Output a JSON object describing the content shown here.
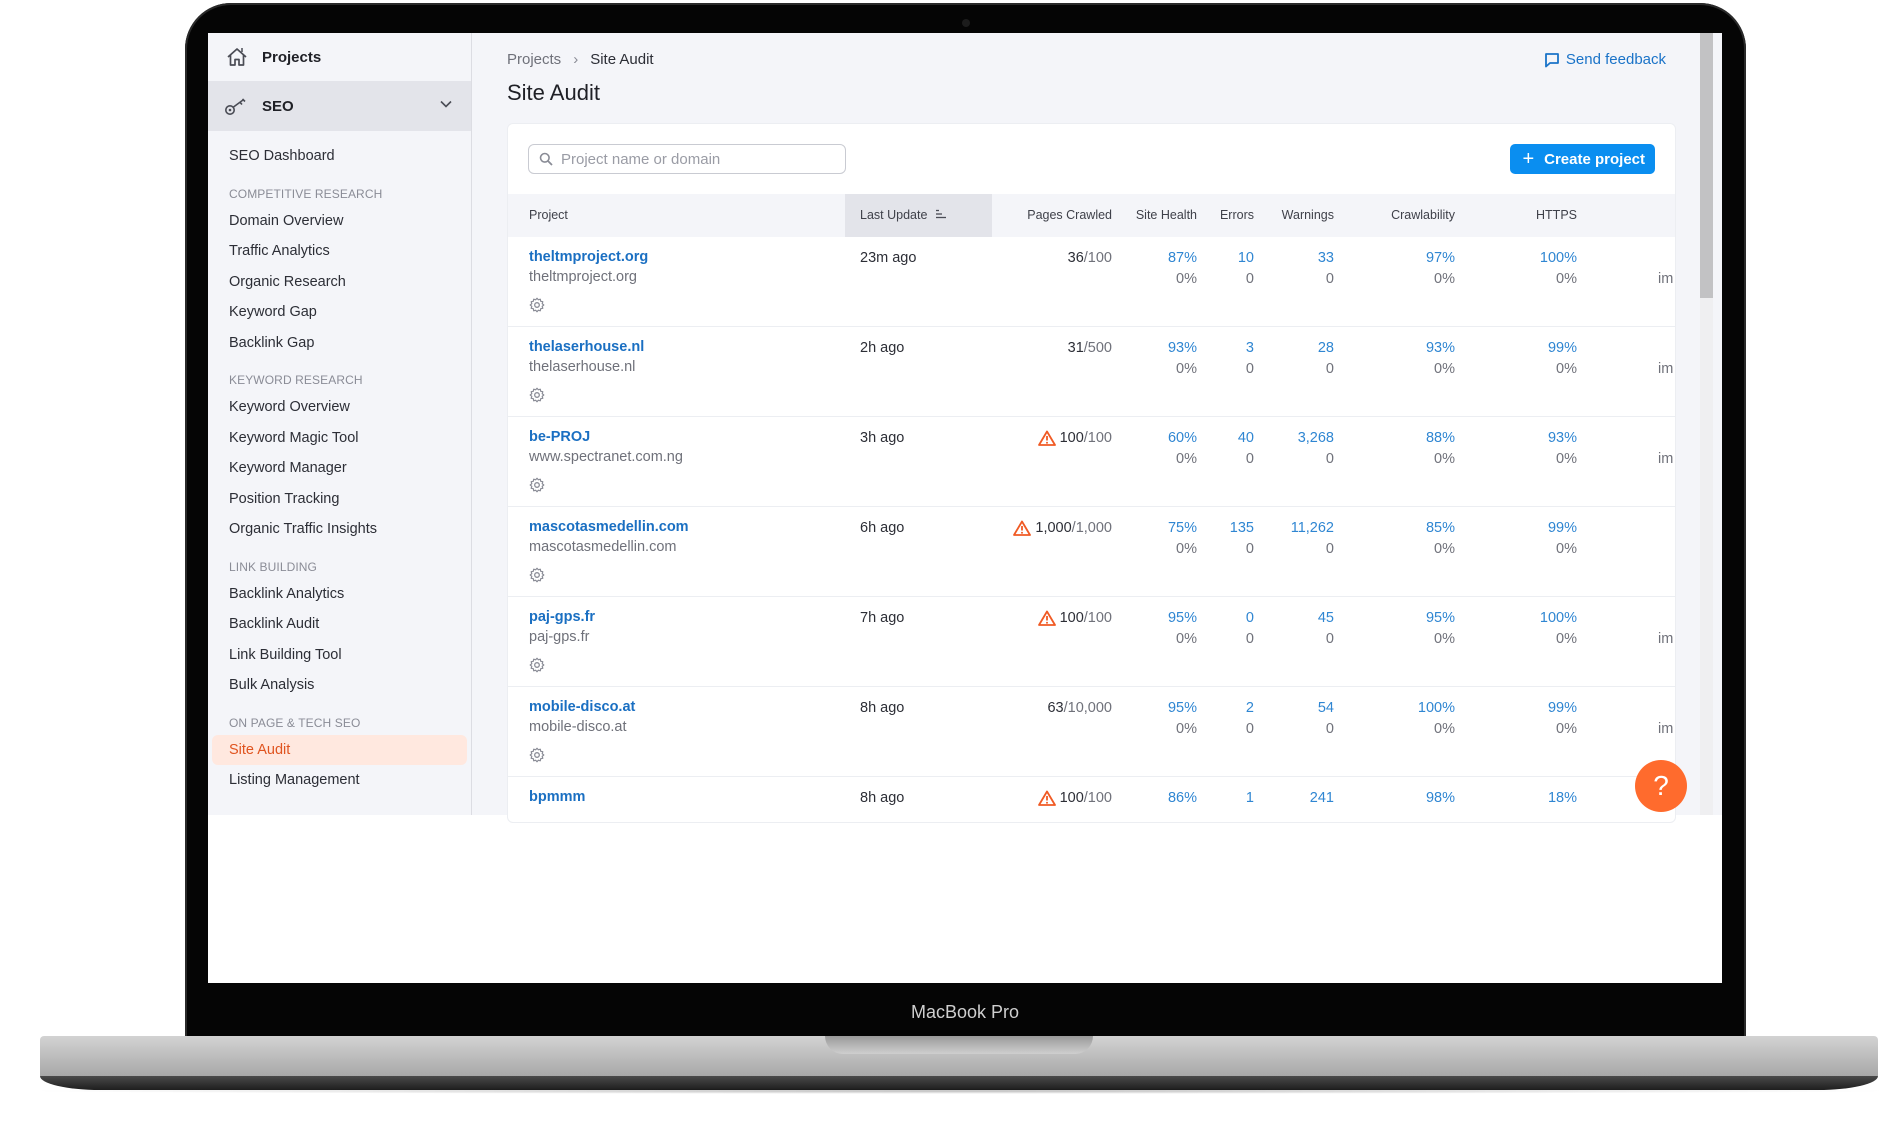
{
  "device": {
    "label": "MacBook Pro"
  },
  "sidebar": {
    "top_label": "Projects",
    "section_label": "SEO",
    "dashboard": "SEO Dashboard",
    "groups": [
      {
        "title": "COMPETITIVE RESEARCH",
        "items": [
          "Domain Overview",
          "Traffic Analytics",
          "Organic Research",
          "Keyword Gap",
          "Backlink Gap"
        ]
      },
      {
        "title": "KEYWORD RESEARCH",
        "items": [
          "Keyword Overview",
          "Keyword Magic Tool",
          "Keyword Manager",
          "Position Tracking",
          "Organic Traffic Insights"
        ]
      },
      {
        "title": "LINK BUILDING",
        "items": [
          "Backlink Analytics",
          "Backlink Audit",
          "Link Building Tool",
          "Bulk Analysis"
        ]
      },
      {
        "title": "ON PAGE & TECH SEO",
        "items": [
          "Site Audit",
          "Listing Management"
        ]
      }
    ],
    "active_item": "Site Audit"
  },
  "header": {
    "breadcrumb": [
      "Projects",
      "Site Audit"
    ],
    "title": "Site Audit",
    "feedback_label": "Send feedback"
  },
  "toolbar": {
    "search_placeholder": "Project name or domain",
    "search_value": "",
    "create_label": "Create project"
  },
  "table": {
    "columns": [
      "Project",
      "Last Update",
      "Pages Crawled",
      "Site Health",
      "Errors",
      "Warnings",
      "Crawlability",
      "HTTPS"
    ],
    "sorted_column": "Last Update",
    "rows": [
      {
        "name": "theltmproject.org",
        "domain": "theltmproject.org",
        "updated": "23m ago",
        "pages_crawled": "36",
        "pages_limit": "/100",
        "limit_warning": false,
        "site_health": "87%",
        "site_health_delta": "0%",
        "errors": "10",
        "errors_delta": "0",
        "warnings": "33",
        "warnings_delta": "0",
        "crawlability": "97%",
        "crawlability_delta": "0%",
        "https": "100%",
        "https_delta": "0%",
        "truncated": "im"
      },
      {
        "name": "thelaserhouse.nl",
        "domain": "thelaserhouse.nl",
        "updated": "2h ago",
        "pages_crawled": "31",
        "pages_limit": "/500",
        "limit_warning": false,
        "site_health": "93%",
        "site_health_delta": "0%",
        "errors": "3",
        "errors_delta": "0",
        "warnings": "28",
        "warnings_delta": "0",
        "crawlability": "93%",
        "crawlability_delta": "0%",
        "https": "99%",
        "https_delta": "0%",
        "truncated": "im"
      },
      {
        "name": "be-PROJ",
        "domain": "www.spectranet.com.ng",
        "updated": "3h ago",
        "pages_crawled": "100",
        "pages_limit": "/100",
        "limit_warning": true,
        "site_health": "60%",
        "site_health_delta": "0%",
        "errors": "40",
        "errors_delta": "0",
        "warnings": "3,268",
        "warnings_delta": "0",
        "crawlability": "88%",
        "crawlability_delta": "0%",
        "https": "93%",
        "https_delta": "0%",
        "truncated": "im"
      },
      {
        "name": "mascotasmedellin.com",
        "domain": "mascotasmedellin.com",
        "updated": "6h ago",
        "pages_crawled": "1,000",
        "pages_limit": "/1,000",
        "limit_warning": true,
        "site_health": "75%",
        "site_health_delta": "0%",
        "errors": "135",
        "errors_delta": "0",
        "warnings": "11,262",
        "warnings_delta": "0",
        "crawlability": "85%",
        "crawlability_delta": "0%",
        "https": "99%",
        "https_delta": "0%",
        "truncated": ""
      },
      {
        "name": "paj-gps.fr",
        "domain": "paj-gps.fr",
        "updated": "7h ago",
        "pages_crawled": "100",
        "pages_limit": "/100",
        "limit_warning": true,
        "site_health": "95%",
        "site_health_delta": "0%",
        "errors": "0",
        "errors_delta": "0",
        "warnings": "45",
        "warnings_delta": "0",
        "crawlability": "95%",
        "crawlability_delta": "0%",
        "https": "100%",
        "https_delta": "0%",
        "truncated": "im"
      },
      {
        "name": "mobile-disco.at",
        "domain": "mobile-disco.at",
        "updated": "8h ago",
        "pages_crawled": "63",
        "pages_limit": "/10,000",
        "limit_warning": false,
        "site_health": "95%",
        "site_health_delta": "0%",
        "errors": "2",
        "errors_delta": "0",
        "warnings": "54",
        "warnings_delta": "0",
        "crawlability": "100%",
        "crawlability_delta": "0%",
        "https": "99%",
        "https_delta": "0%",
        "truncated": "im"
      },
      {
        "name": "bpmmm",
        "domain": "",
        "updated": "8h ago",
        "pages_crawled": "100",
        "pages_limit": "/100",
        "limit_warning": true,
        "site_health": "86%",
        "site_health_delta": "",
        "errors": "1",
        "errors_delta": "",
        "warnings": "241",
        "warnings_delta": "",
        "crawlability": "98%",
        "crawlability_delta": "",
        "https": "18%",
        "https_delta": "",
        "truncated": ""
      }
    ]
  },
  "help_button": {
    "label": "?"
  },
  "colors": {
    "accent": "#0a8ef0",
    "link": "#1a6fc2",
    "active": "#e0541f",
    "active_bg": "#ffe8df",
    "warning": "#f05a24",
    "help": "#ff6b2d"
  }
}
